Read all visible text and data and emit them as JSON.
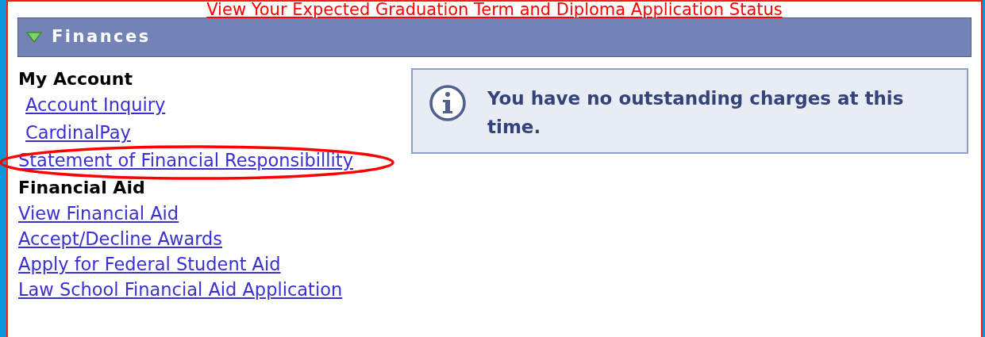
{
  "top_link": "View Your Expected Graduation Term and Diploma Application Status",
  "section": {
    "title": "Finances",
    "expanded": true
  },
  "groups": [
    {
      "heading": "My Account",
      "sub_links": [
        "Account Inquiry",
        "CardinalPay"
      ],
      "links": [
        "Statement of Financial Responsibillity"
      ]
    },
    {
      "heading": "Financial Aid",
      "links": [
        "View Financial Aid",
        "Accept/Decline Awards",
        "Apply for Federal Student Aid",
        "Law School Financial Aid Application"
      ]
    }
  ],
  "message": "You have no outstanding charges at this time."
}
